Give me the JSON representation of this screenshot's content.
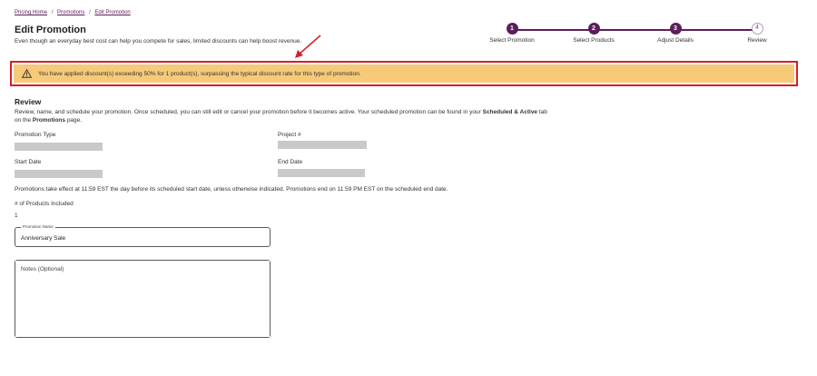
{
  "breadcrumb": {
    "items": [
      {
        "label": "Pricing Home"
      },
      {
        "label": "Promotions"
      },
      {
        "label": "Edit Promotion"
      }
    ],
    "separator": "/"
  },
  "header": {
    "title": "Edit Promotion",
    "subtitle": "Even though an everyday best cost can help you compete for sales, limited discounts can help boost revenue."
  },
  "stepper": {
    "active_color": "#5b1e5a",
    "steps": [
      {
        "number": "1",
        "label": "Select Promotion",
        "state": "complete"
      },
      {
        "number": "2",
        "label": "Select Products",
        "state": "complete"
      },
      {
        "number": "3",
        "label": "Adjust Details",
        "state": "complete"
      },
      {
        "number": "4",
        "label": "Review",
        "state": "pending"
      }
    ]
  },
  "alert": {
    "icon": "warning-triangle-icon",
    "message": "You have applied discount(s) exceeding 50% for 1 product(s), surpassing the typical discount rate for this type of promotion.",
    "background": "#f6ca79",
    "highlight_border": "#d41f2a"
  },
  "review": {
    "title": "Review",
    "desc_part1": "Review, name, and schedule your promotion. Once scheduled, you can still edit or cancel your promotion before it becomes active. Your scheduled promotion can be found in your ",
    "desc_bold1": "Scheduled & Active",
    "desc_part2": " tab on the ",
    "desc_bold2": "Promotions",
    "desc_part3": " page.",
    "fields": {
      "promotion_type": "Promotion Type",
      "project_number": "Project #",
      "start_date": "Start Date",
      "end_date": "End Date"
    },
    "schedule_note": "Promotions take effect at 11:59 EST the day before its scheduled start date, unless otherwise indicated. Promotions end on 11:59 PM EST on the scheduled end date.",
    "products_label": "# of Products Included",
    "products_count": "1"
  },
  "form": {
    "name_label": "Promotion Name",
    "name_value": "Anniversary Sale",
    "notes_placeholder": "Notes (Optional)"
  }
}
